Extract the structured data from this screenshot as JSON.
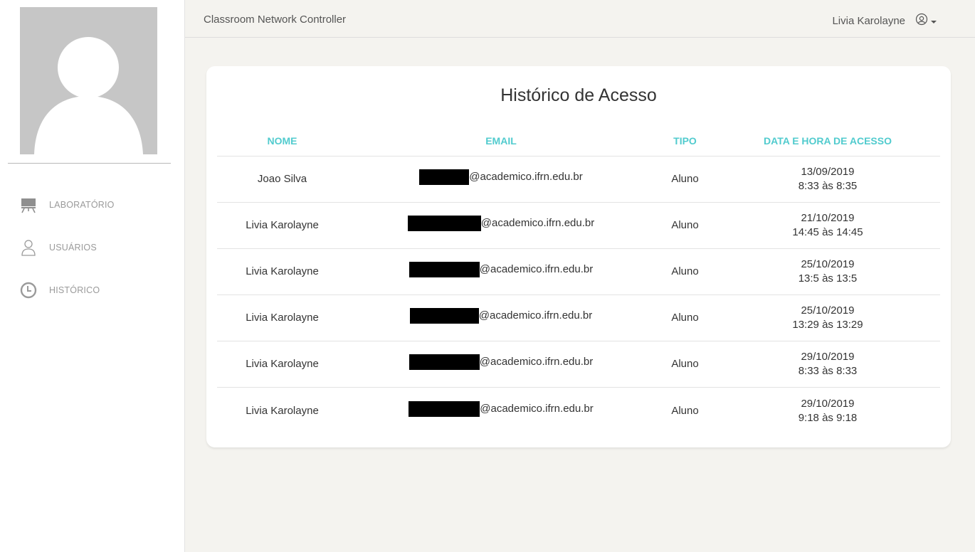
{
  "navbar": {
    "brand": "Classroom Network Controller",
    "user_name": "Livia Karolayne",
    "user_icon": "user-circle-icon",
    "caret_icon": "caret-down-icon"
  },
  "sidebar": {
    "avatar_icon": "default-avatar-icon",
    "items": [
      {
        "label": "LABORATÓRIO",
        "icon": "classroom-icon"
      },
      {
        "label": "USUÁRIOS",
        "icon": "user-icon"
      },
      {
        "label": "HISTÓRICO",
        "icon": "clock-icon"
      }
    ]
  },
  "main": {
    "title": "Histórico de Acesso",
    "columns": [
      "NOME",
      "EMAIL",
      "TIPO",
      "DATA E HORA DE ACESSO"
    ],
    "rows": [
      {
        "name": "Joao Silva",
        "email_domain": "@academico.ifrn.edu.br",
        "type": "Aluno",
        "date": "13/09/2019",
        "time": "8:33 às 8:35"
      },
      {
        "name": "Livia Karolayne",
        "email_domain": "@academico.ifrn.edu.br",
        "type": "Aluno",
        "date": "21/10/2019",
        "time": "14:45 às 14:45"
      },
      {
        "name": "Livia Karolayne",
        "email_domain": "@academico.ifrn.edu.br",
        "type": "Aluno",
        "date": "25/10/2019",
        "time": "13:5 às 13:5"
      },
      {
        "name": "Livia Karolayne",
        "email_domain": "@academico.ifrn.edu.br",
        "type": "Aluno",
        "date": "25/10/2019",
        "time": "13:29 às 13:29"
      },
      {
        "name": "Livia Karolayne",
        "email_domain": "@academico.ifrn.edu.br",
        "type": "Aluno",
        "date": "29/10/2019",
        "time": "8:33 às 8:33"
      },
      {
        "name": "Livia Karolayne",
        "email_domain": "@academico.ifrn.edu.br",
        "type": "Aluno",
        "date": "29/10/2019",
        "time": "9:18 às 9:18"
      }
    ]
  },
  "colors": {
    "accent": "#51cbce",
    "background": "#f4f3ef",
    "redaction": "#000000"
  }
}
